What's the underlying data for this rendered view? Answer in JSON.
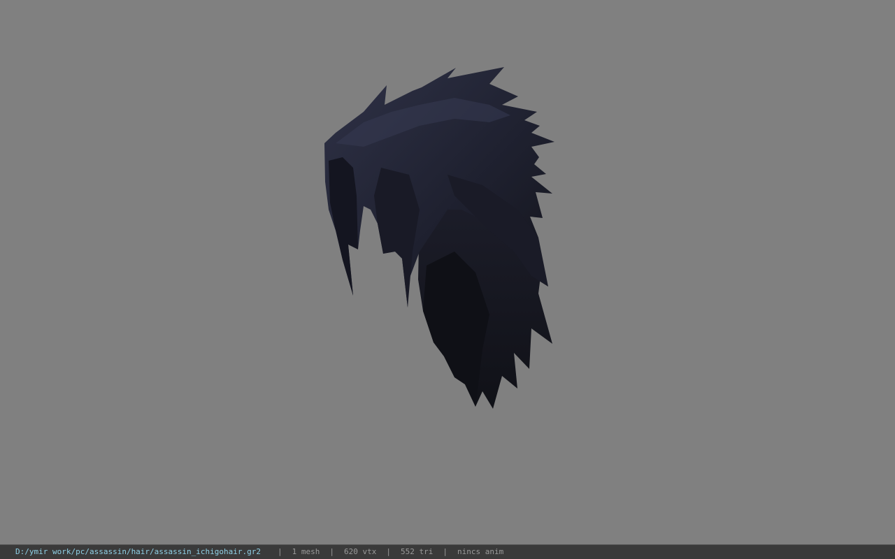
{
  "viewport": {
    "background": "#808080",
    "model_colors": {
      "dark": "#15161d",
      "mid": "#232533",
      "light": "#30334a"
    }
  },
  "status_bar": {
    "file_path": "D:/ymir work/pc/assassin/hair/assassin_ichigohair.gr2",
    "separator": "|",
    "mesh_count": "1 mesh",
    "vertex_count": "620 vtx",
    "triangle_count": "552 tri",
    "anim_status": "nincs anim"
  }
}
